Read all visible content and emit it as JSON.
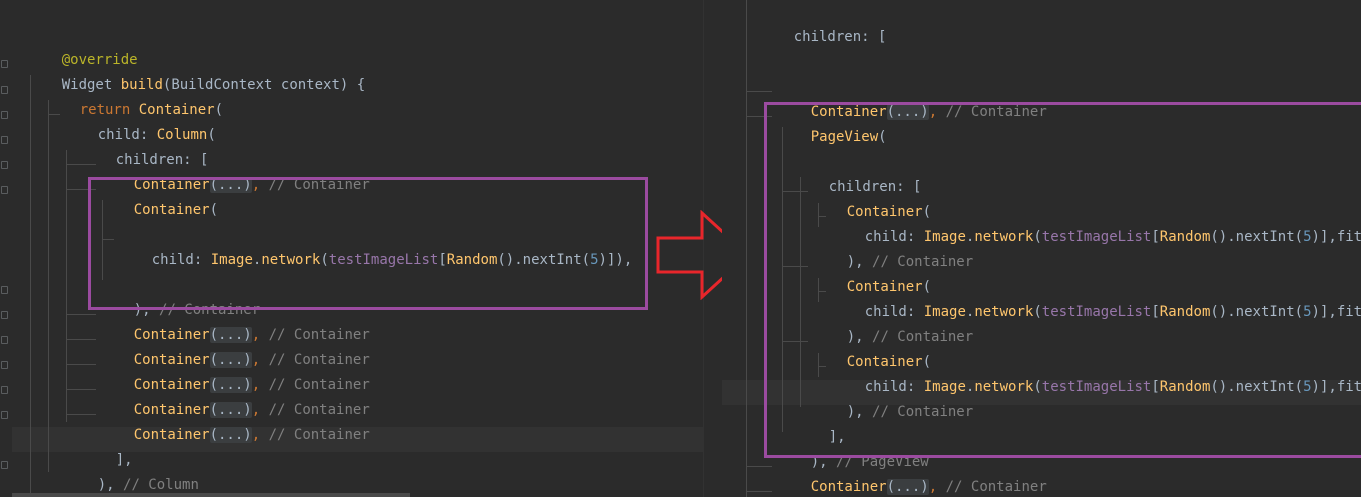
{
  "left": {
    "override": "@override",
    "widget_kw": "Widget ",
    "build_fn": "build",
    "build_args": "(BuildContext context) {",
    "return_kw": "return ",
    "container": "Container",
    "open_paren": "(",
    "child_kw": "child: ",
    "column": "Column",
    "children": "children: [",
    "fold_text": "(...)",
    "comma": ",",
    "comment_container": "// Container",
    "image_cls": "Image",
    "dot": ".",
    "network": "network",
    "open_p": "(",
    "test_list": "testImageList",
    "lbrack": "[",
    "random": "Random",
    "nextint": "().nextInt(",
    "five": "5",
    "close_tail": ")]),",
    "close_paren_comma": "),",
    "list_close": "],",
    "comment_column": "// Column",
    "last_close": ");"
  },
  "right": {
    "children": "children: [",
    "container": "Container",
    "fold_text": "(...)",
    "comma": ",",
    "comment_container": "// Container",
    "pageview": "PageView",
    "open_paren": "(",
    "child_kw": "child: ",
    "image_cls": "Image",
    "dot": ".",
    "network": "network",
    "test_list": "testImageList",
    "lbrack": "[",
    "random": "Random",
    "nextint": "().nextInt(",
    "five": "5",
    "close_tail": ")],fit",
    "close_paren_comma": "),",
    "list_close": "],",
    "comment_pageview": "// PageView"
  },
  "annotation": {
    "box_color": "#9b4ba0",
    "arrow_color": "#e8262b"
  }
}
